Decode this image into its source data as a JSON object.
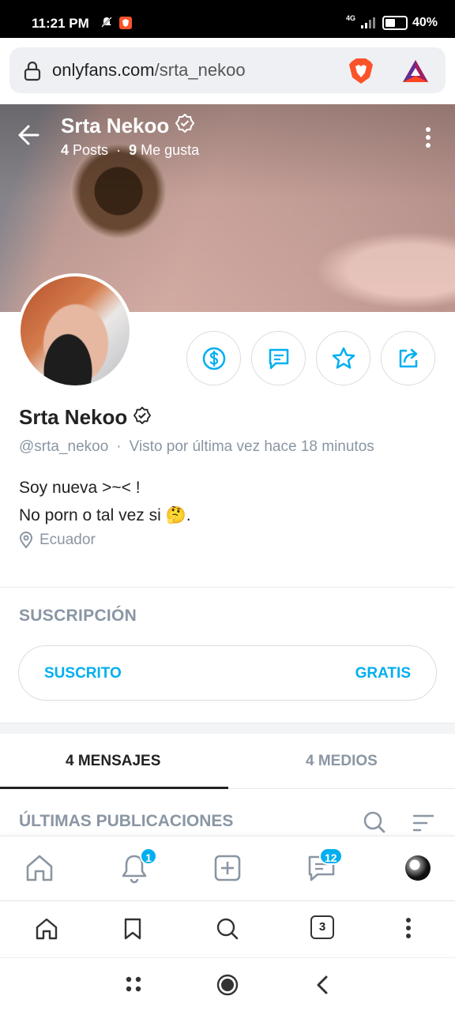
{
  "status_bar": {
    "time": "11:21 PM",
    "network": "4G",
    "battery": "40%"
  },
  "browser": {
    "url_domain": "onlyfans.com",
    "url_path": "/srta_nekoo",
    "tab_count": "3"
  },
  "header": {
    "name": "Srta Nekoo",
    "posts_count": "4",
    "posts_label": "Posts",
    "likes_count": "9",
    "likes_label": "Me gusta"
  },
  "profile": {
    "name": "Srta Nekoo",
    "handle": "@srta_nekoo",
    "last_seen": "Visto por última vez hace 18 minutos",
    "bio_line1": "Soy nueva >~< !",
    "bio_line2": "No porn o tal vez si 🤔.",
    "location": "Ecuador"
  },
  "subscription": {
    "title": "SUSCRIPCIÓN",
    "status": "SUSCRITO",
    "price": "GRATIS"
  },
  "tabs": [
    {
      "label": "4 MENSAJES",
      "active": true
    },
    {
      "label": "4 MEDIOS",
      "active": false
    }
  ],
  "feed": {
    "section_title": "ÚLTIMAS PUBLICACIONES"
  },
  "app_nav": {
    "notifications_badge": "1",
    "messages_badge": "12"
  },
  "colors": {
    "accent": "#00aff0",
    "muted": "#8a96a3",
    "text": "#222222"
  }
}
